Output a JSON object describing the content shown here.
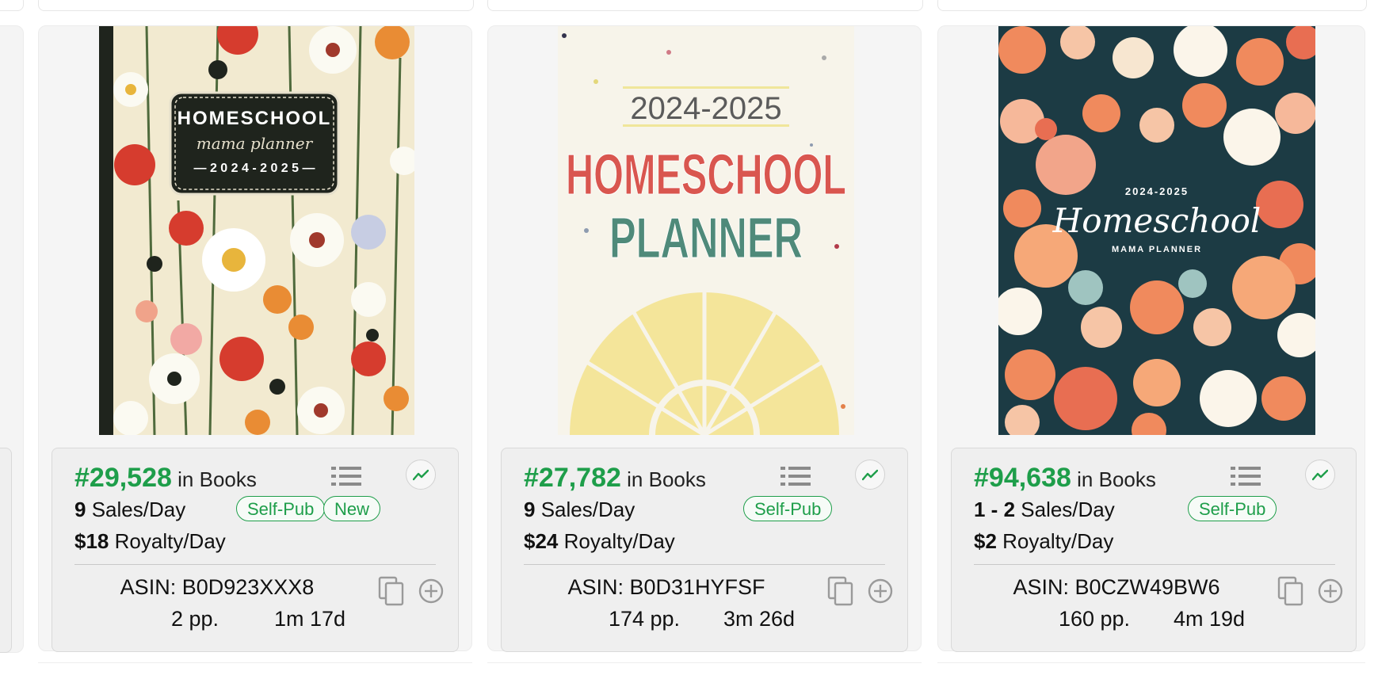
{
  "products": [
    {
      "cover": {
        "top_text": "HOMESCHOOL",
        "script_text": "mama planner",
        "year_text": "— 2 0 2 4 - 2 0 2 5 —"
      },
      "rank_number": "#29,528",
      "rank_label": "in Books",
      "sales_value": "9",
      "sales_label": "Sales/Day",
      "royalty_value": "$18",
      "royalty_label": "Royalty/Day",
      "badges": [
        "Self-Pub",
        "New"
      ],
      "asin": "ASIN: B0D923XXX8",
      "pages": "2 pp.",
      "age": "1m 17d"
    },
    {
      "cover": {
        "year_text": "2024-2025",
        "line1": "HOMESCHOOL",
        "line2": "PLANNER"
      },
      "rank_number": "#27,782",
      "rank_label": "in Books",
      "sales_value": "9",
      "sales_label": "Sales/Day",
      "royalty_value": "$24",
      "royalty_label": "Royalty/Day",
      "badges": [
        "Self-Pub"
      ],
      "asin": "ASIN: B0D31HYFSF",
      "pages": "174 pp.",
      "age": "3m 26d"
    },
    {
      "cover": {
        "year_text": "2024-2025",
        "script_text": "Homeschool",
        "sub_text": "MAMA PLANNER"
      },
      "rank_number": "#94,638",
      "rank_label": "in Books",
      "sales_value": "1 - 2",
      "sales_label": "Sales/Day",
      "royalty_value": "$2",
      "royalty_label": "Royalty/Day",
      "badges": [
        "Self-Pub"
      ],
      "asin": "ASIN: B0CZW49BW6",
      "pages": "160 pp.",
      "age": "4m 19d"
    }
  ],
  "colors": {
    "accent_green": "#1e9e4a",
    "card_bg": "#f5f5f5",
    "info_bg": "#efefef"
  },
  "icons": [
    "list-icon",
    "trend-chart-icon",
    "copy-icon",
    "add-circle-icon"
  ]
}
